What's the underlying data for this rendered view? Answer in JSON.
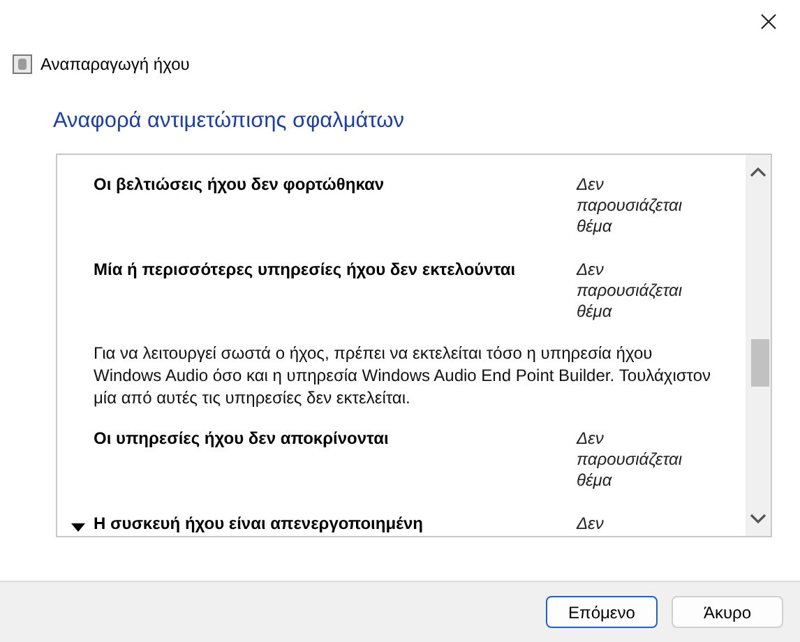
{
  "window": {
    "title": "Αναπαραγωγή ήχου"
  },
  "heading": "Αναφορά αντιμετώπισης σφαλμάτων",
  "issues": [
    {
      "title": "Οι βελτιώσεις ήχου δεν φορτώθηκαν",
      "status": "Δεν παρουσιάζεται θέμα",
      "selected": false
    },
    {
      "title": "Μία ή περισσότερες υπηρεσίες ήχου δεν εκτελούνται",
      "status": "Δεν παρουσιάζεται θέμα",
      "selected": false,
      "detail": "Για να λειτουργεί σωστά ο ήχος, πρέπει να εκτελείται τόσο η υπηρεσία ήχου Windows Audio όσο και η υπηρεσία Windows Audio End Point Builder. Τουλάχιστον μία από αυτές τις υπηρεσίες δεν εκτελείται."
    },
    {
      "title": "Οι υπηρεσίες ήχου δεν αποκρίνονται",
      "status": "Δεν παρουσιάζεται θέμα",
      "selected": false
    },
    {
      "title": "Η συσκευή ήχου είναι απενεργοποιημένη",
      "status": "Δεν",
      "selected": true
    }
  ],
  "buttons": [
    {
      "label": "Επόμενο",
      "kind": "primary"
    },
    {
      "label": "Άκυρο",
      "kind": "secondary"
    }
  ]
}
